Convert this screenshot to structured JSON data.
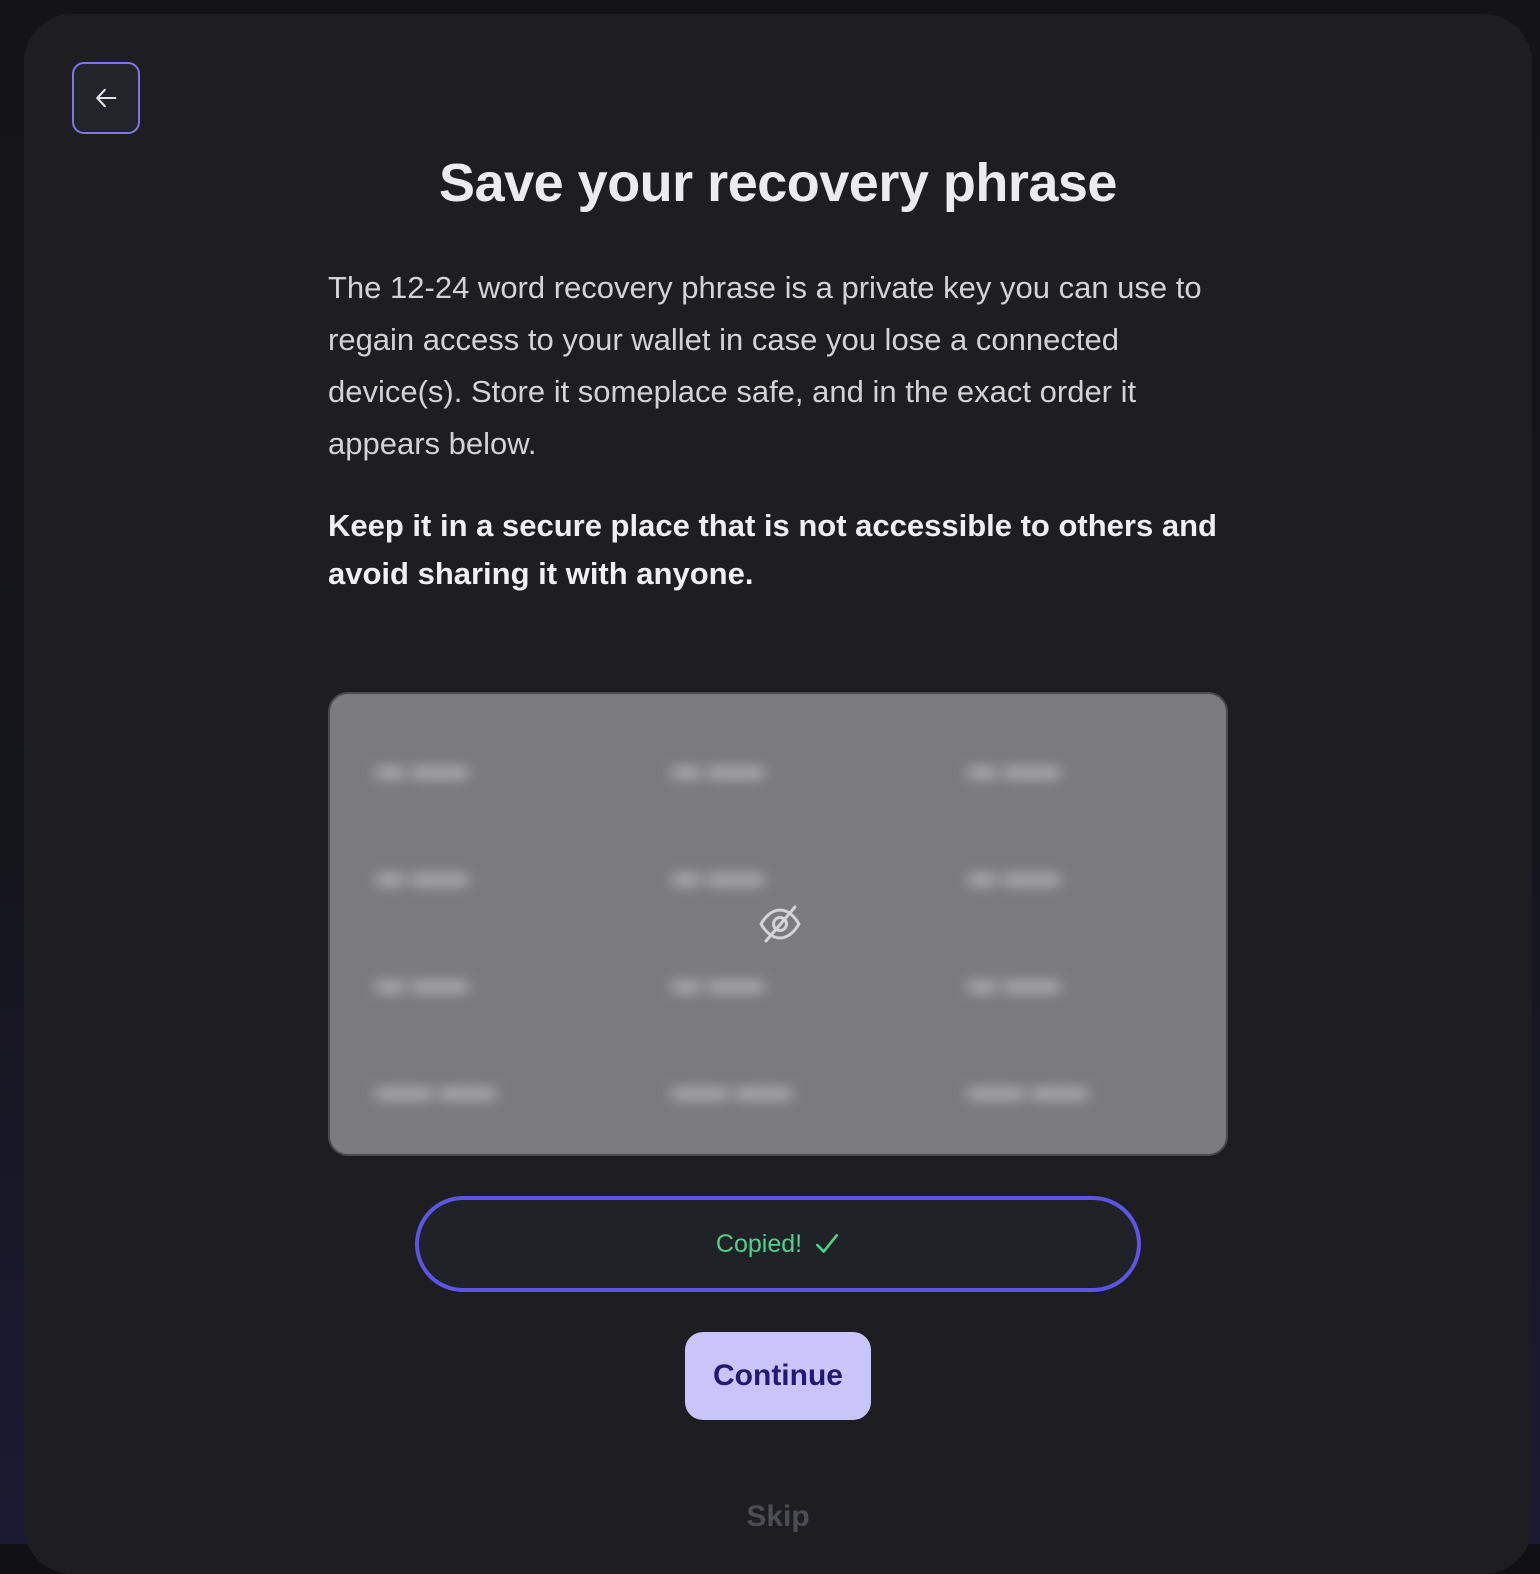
{
  "header": {
    "back_icon": "arrow-left-icon",
    "title": "Save your recovery phrase"
  },
  "content": {
    "description": "The 12-24 word recovery phrase is a private key you can use to regain access to your wallet in case you lose a connected device(s). Store it someplace safe, and in the exact order it appears below.",
    "warning": "Keep it in a secure place that is not accessible to others and avoid sharing it with anyone."
  },
  "phrase": {
    "hidden_icon": "eye-off-icon"
  },
  "actions": {
    "copy_label": "Copied!",
    "copy_icon": "checkmark-icon",
    "continue_label": "Continue",
    "skip_label": "Skip"
  },
  "colors": {
    "accent": "#5e55e6",
    "success": "#4fd386",
    "primary_button": "#c9c5fb"
  }
}
